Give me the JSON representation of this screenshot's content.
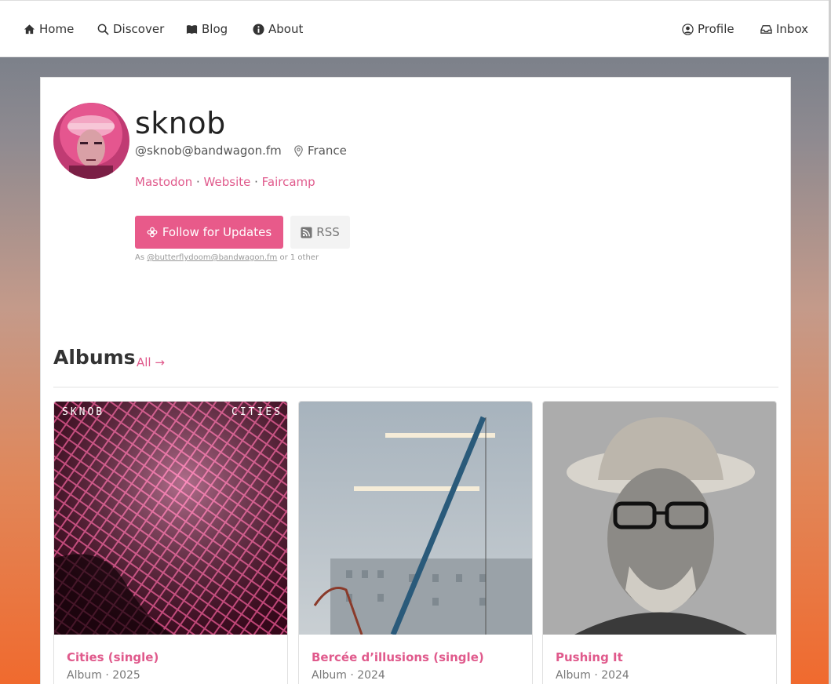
{
  "nav": {
    "home": "Home",
    "discover": "Discover",
    "blog": "Blog",
    "about": "About",
    "profile": "Profile",
    "inbox": "Inbox"
  },
  "profile": {
    "display_name": "sknob",
    "handle": "@sknob@bandwagon.fm",
    "location": "France",
    "links": [
      "Mastodon",
      "Website",
      "Faircamp"
    ],
    "follow_label": "Follow for Updates",
    "rss_label": "RSS",
    "as_prefix": "As",
    "as_account": "@butterflydoom@bandwagon.fm",
    "as_suffix": "or 1 other"
  },
  "albums": {
    "heading": "Albums",
    "all_label": "All",
    "items": [
      {
        "title": "Cities (single)",
        "meta": "Album · 2025",
        "cover_left": "SKNOB",
        "cover_right": "CITIES"
      },
      {
        "title": "Bercée d’illusions (single)",
        "meta": "Album · 2024"
      },
      {
        "title": "Pushing It",
        "meta": "Album · 2024"
      }
    ]
  },
  "colors": {
    "accent": "#e85a8a",
    "link": "#e05a8c"
  }
}
